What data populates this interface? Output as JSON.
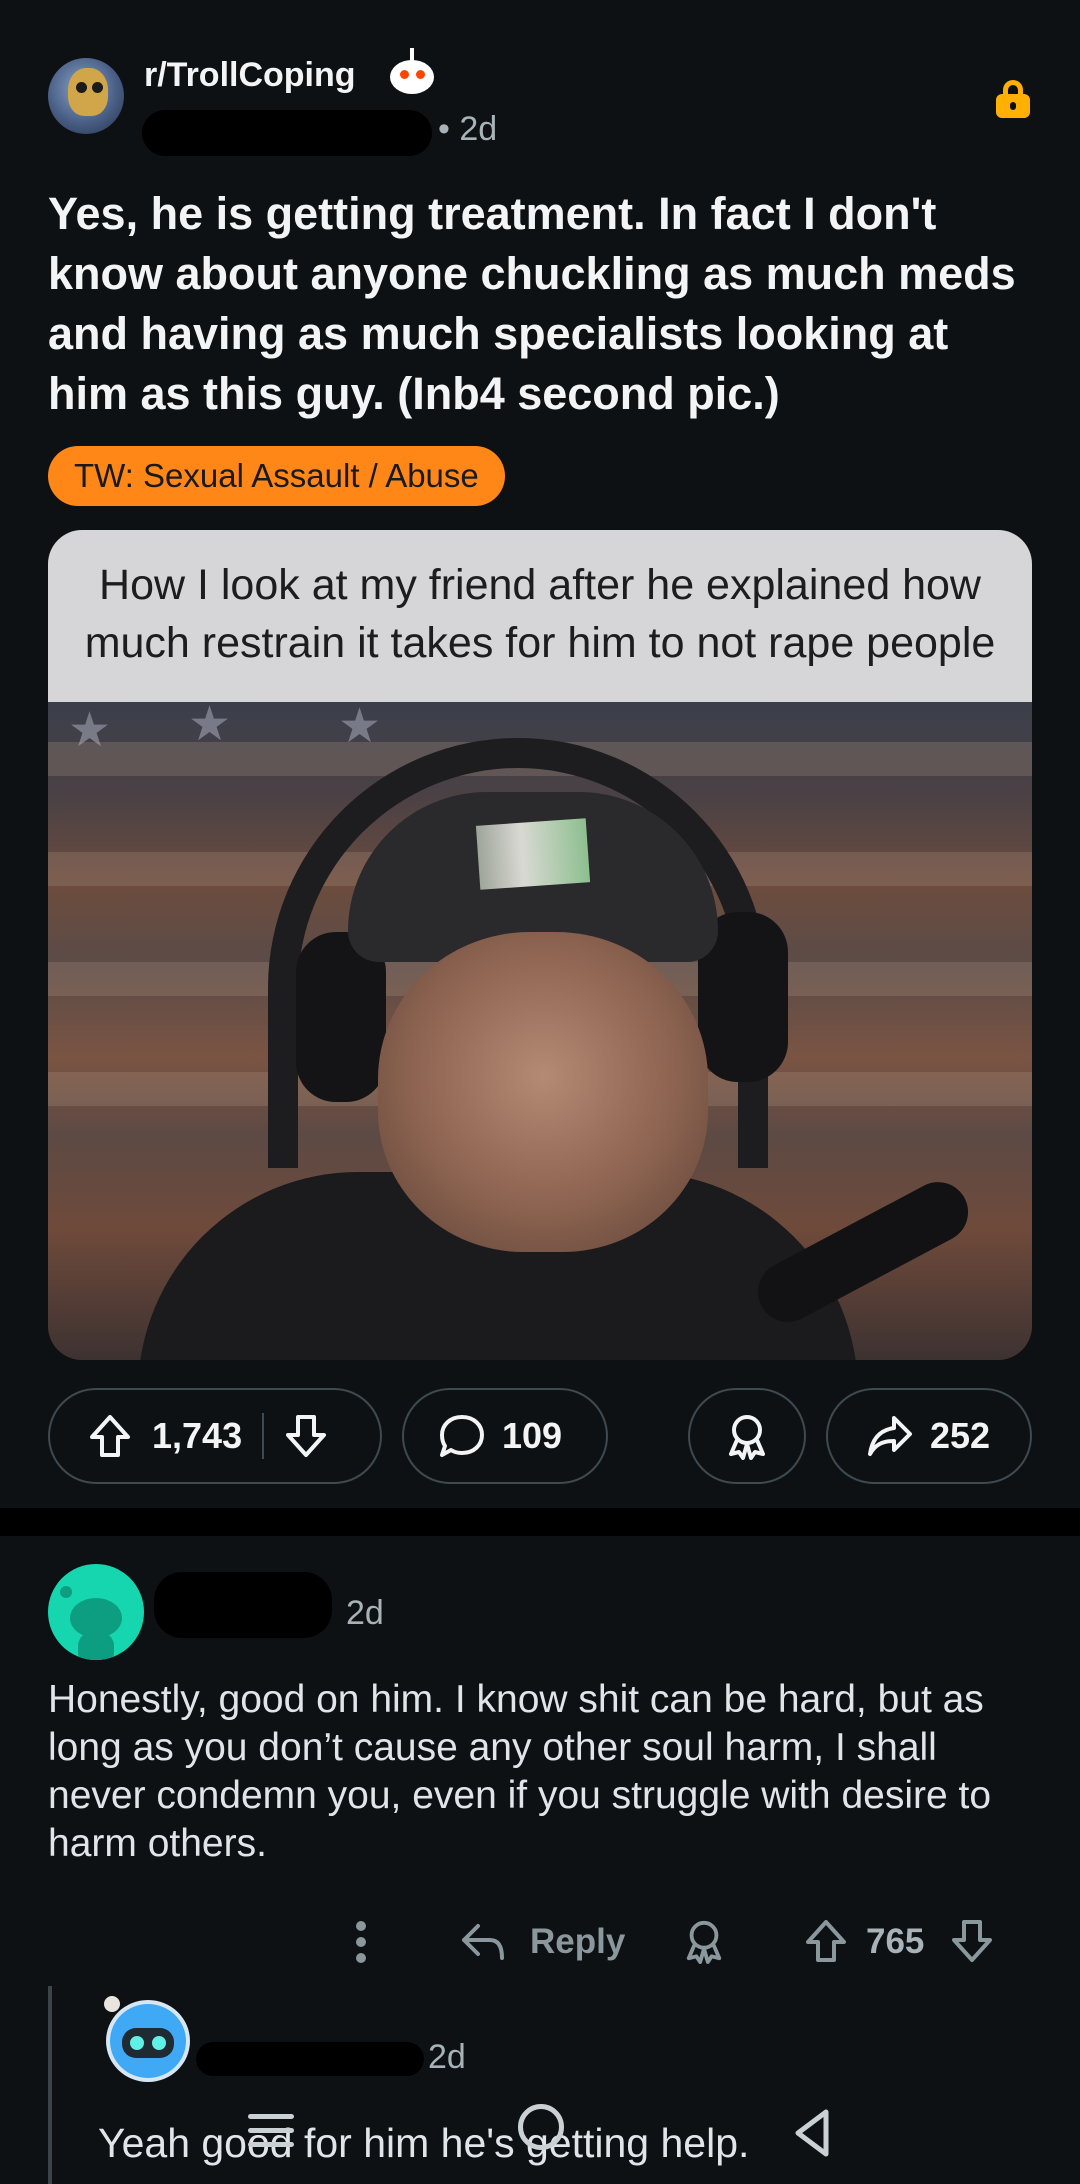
{
  "post": {
    "subreddit": "r/TrollCoping",
    "time": "• 2d",
    "title": "Yes, he is getting treatment. In fact I don't know about anyone chuckling as much meds and having as much specialists looking at him as this guy. (Inb4 second pic.)",
    "flair": "TW: Sexual Assault / Abuse",
    "meme_caption": "How I look at my friend after he explained how much restrain it takes for him to not rape people",
    "upvotes": "1,743",
    "comments": "109",
    "shares": "252"
  },
  "comment": {
    "time": "2d",
    "body": "Honestly, good on him. I know shit can be hard, but as long as you don’t cause any other soul harm, I shall never condemn you, even if you struggle with desire to harm others.",
    "reply_label": "Reply",
    "score": "765"
  },
  "reply": {
    "time": "2d",
    "body": "Yeah good for him he's getting help."
  },
  "colors": {
    "background": "#0e1113",
    "flair": "#ff8717",
    "lock": "#ffb000",
    "avatar_teal": "#16d6b0"
  },
  "icons": [
    "upvote-icon",
    "downvote-icon",
    "comment-icon",
    "award-icon",
    "share-icon",
    "lock-icon",
    "reply-icon",
    "more-icon"
  ]
}
